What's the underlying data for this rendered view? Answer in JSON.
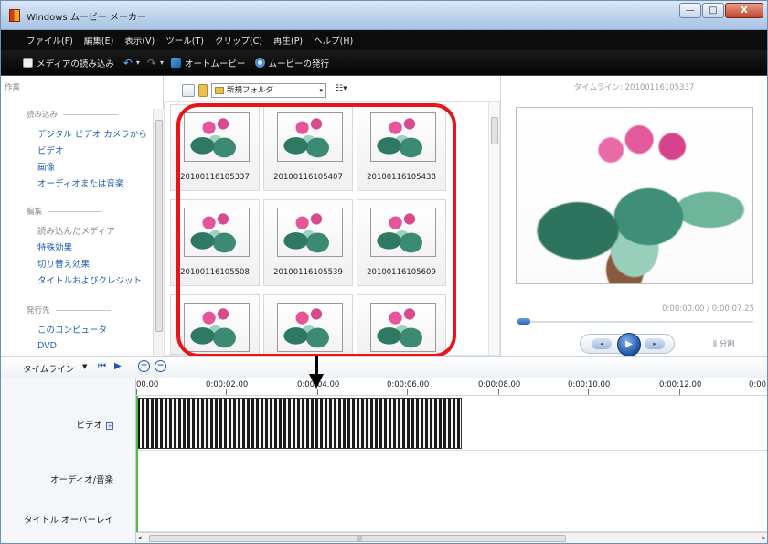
{
  "window": {
    "title": "Windows ムービー メーカー",
    "controls": {
      "minimize": "—",
      "maximize": "□",
      "close": "X"
    }
  },
  "menu": [
    "ファイル(F)",
    "編集(E)",
    "表示(V)",
    "ツール(T)",
    "クリップ(C)",
    "再生(P)",
    "ヘルプ(H)"
  ],
  "toolbar": {
    "import_media": "メディアの読み込み",
    "undo_icon": "↶",
    "redo_icon": "↷",
    "caret": "▾",
    "automovie": "オートムービー",
    "publish": "ムービーの発行"
  },
  "tasks": {
    "header": "作業",
    "sections": [
      {
        "title": "読み込み",
        "items": [
          {
            "label": "デジタル ビデオ カメラから",
            "enabled": true
          },
          {
            "label": "ビデオ",
            "enabled": true
          },
          {
            "label": "画像",
            "enabled": true
          },
          {
            "label": "オーディオまたは音楽",
            "enabled": true
          }
        ]
      },
      {
        "title": "編集",
        "items": [
          {
            "label": "読み込んだメディア",
            "enabled": false
          },
          {
            "label": "特殊効果",
            "enabled": true
          },
          {
            "label": "切り替え効果",
            "enabled": true
          },
          {
            "label": "タイトルおよびクレジット",
            "enabled": true
          }
        ]
      },
      {
        "title": "発行先",
        "items": [
          {
            "label": "このコンピュータ",
            "enabled": true
          },
          {
            "label": "DVD",
            "enabled": true
          }
        ]
      }
    ]
  },
  "collection": {
    "folder": "新規フォルダ",
    "caret": "▾",
    "view_icon": "☷▾",
    "items": [
      {
        "label": "20100116105337"
      },
      {
        "label": "20100116105407"
      },
      {
        "label": "20100116105438"
      },
      {
        "label": "20100116105508"
      },
      {
        "label": "20100116105539"
      },
      {
        "label": "20100116105609"
      },
      {
        "label": ""
      },
      {
        "label": ""
      },
      {
        "label": ""
      }
    ]
  },
  "preview": {
    "title": "タイムライン: 20100116105337",
    "time": "0:00:00.00 / 0:00:07.25",
    "seek_fraction": 0.0,
    "split_label": "分割",
    "split_icon": "⫼",
    "prev_icon": "◂",
    "play_icon": "▶",
    "next_icon": "▸"
  },
  "timeline": {
    "label": "タイムライン",
    "caret": "▼",
    "rewind_icon": "⏮",
    "play_icon": "▶",
    "zoom_in": "+",
    "zoom_out": "−",
    "ticks": [
      "00.00",
      "0:00:02.00",
      "0:00:04.00",
      "0:00:06.00",
      "0:00:08.00",
      "0:00:10.00",
      "0:00:12.00",
      "0:00"
    ],
    "tracks": {
      "video": "ビデオ",
      "video_expand": "+",
      "audio": "オーディオ/音楽",
      "title_overlay": "タイトル オーバーレイ"
    },
    "scroll": {
      "left": "◂",
      "right": "▸",
      "grip": "|||"
    }
  },
  "colors": {
    "highlight": "#e8141a",
    "link": "#1f5fb7",
    "menu_bg": "#0c0c0c",
    "playhead": "#54b84a"
  }
}
